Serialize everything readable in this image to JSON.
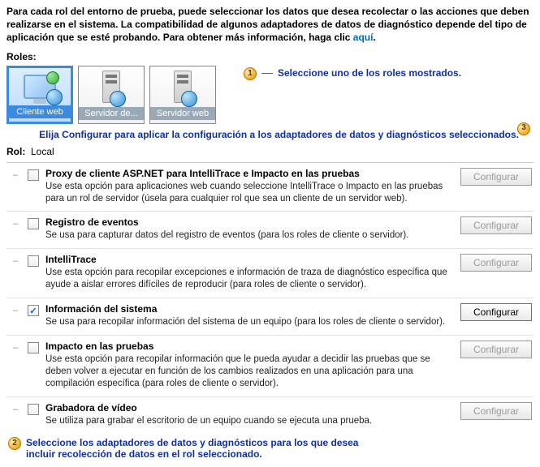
{
  "intro": {
    "text_before_link": "Para cada rol del entorno de prueba, puede seleccionar los datos que desea recolectar o las acciones que deben realizarse en el sistema. La compatibilidad de algunos adaptadores de datos de diagnóstico depende del tipo de aplicación que se esté probando. Para obtener más información, haga clic ",
    "link_text": "aquí",
    "text_after_link": "."
  },
  "roles_label": "Roles:",
  "roles": [
    {
      "label": "Cliente web",
      "selected": true,
      "icon": "monitor"
    },
    {
      "label": "Servidor de...",
      "selected": false,
      "icon": "server"
    },
    {
      "label": "Servidor web",
      "selected": false,
      "icon": "server"
    }
  ],
  "callouts": {
    "c1": "Seleccione uno de los roles mostrados.",
    "c2": "Seleccione los adaptadores de datos y diagnósticos para los que desea incluir recolección de datos en el rol seleccionado.",
    "c3": "Elija Configurar para aplicar la configuración a los adaptadores de datos y diagnósticos seleccionados."
  },
  "rol_label": "Rol:",
  "rol_value": "Local",
  "configure_label": "Configurar",
  "adapters": [
    {
      "title": "Proxy de cliente ASP.NET para IntelliTrace e Impacto en las pruebas",
      "desc": "Use esta opción para aplicaciones web cuando seleccione IntelliTrace o Impacto en las pruebas para un rol de servidor (úsela para cualquier rol que sea un cliente de un servidor web).",
      "checked": false,
      "config_enabled": false
    },
    {
      "title": "Registro de eventos",
      "desc": "Se usa para capturar datos del registro de eventos (para los roles de cliente o servidor).",
      "checked": false,
      "config_enabled": false
    },
    {
      "title": "IntelliTrace",
      "desc": "Use esta opción para recopilar excepciones e información de traza de diagnóstico específica que ayude a aislar errores difíciles de reproducir (para roles de cliente o servidor).",
      "checked": false,
      "config_enabled": false
    },
    {
      "title": "Información del sistema",
      "desc": "Se usa para recopilar información del sistema de un equipo (para los roles de cliente o servidor).",
      "checked": true,
      "config_enabled": true
    },
    {
      "title": "Impacto en las pruebas",
      "desc": "Use esta opción para recopilar información que le pueda ayudar a decidir las pruebas que se deben volver a ejecutar en función de los cambios realizados en una aplicación para una compilación específica (para roles de cliente o servidor).",
      "checked": false,
      "config_enabled": false
    },
    {
      "title": "Grabadora de vídeo",
      "desc": "Se utiliza para grabar el escritorio de un equipo cuando se ejecuta una prueba.",
      "checked": false,
      "config_enabled": false
    }
  ]
}
